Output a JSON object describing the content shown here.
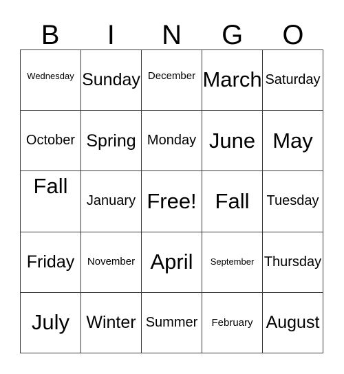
{
  "card": {
    "type": "bingo-card",
    "header_letters": [
      "B",
      "I",
      "N",
      "G",
      "O"
    ],
    "columns": 5,
    "rows": 5,
    "free_space_label": "Free!",
    "free_space_position": {
      "row": 3,
      "column": 3
    },
    "border_color": "#3a3a3a",
    "background_color": "#ffffff",
    "text_color": "#000000",
    "cells": [
      [
        {
          "label": "Wednesday",
          "size": "xs",
          "valign": "hi"
        },
        {
          "label": "Sunday",
          "size": "l",
          "valign": "mid"
        },
        {
          "label": "December",
          "size": "s",
          "valign": "hi"
        },
        {
          "label": "March",
          "size": "xl",
          "valign": "mid"
        },
        {
          "label": "Saturday",
          "size": "m",
          "valign": "mid"
        }
      ],
      [
        {
          "label": "October",
          "size": "m",
          "valign": "mid"
        },
        {
          "label": "Spring",
          "size": "l",
          "valign": "mid"
        },
        {
          "label": "Monday",
          "size": "m",
          "valign": "mid"
        },
        {
          "label": "June",
          "size": "xl",
          "valign": "mid"
        },
        {
          "label": "May",
          "size": "xl",
          "valign": "mid"
        }
      ],
      [
        {
          "label": "Fall",
          "size": "xl",
          "valign": "top"
        },
        {
          "label": "January",
          "size": "m",
          "valign": "mid"
        },
        {
          "label": "Free!",
          "size": "xl",
          "valign": "mid"
        },
        {
          "label": "Fall",
          "size": "xl",
          "valign": "mid"
        },
        {
          "label": "Tuesday",
          "size": "m",
          "valign": "mid"
        }
      ],
      [
        {
          "label": "Friday",
          "size": "l",
          "valign": "mid"
        },
        {
          "label": "November",
          "size": "s",
          "valign": "mid"
        },
        {
          "label": "April",
          "size": "xl",
          "valign": "mid"
        },
        {
          "label": "September",
          "size": "xs",
          "valign": "mid"
        },
        {
          "label": "Thursday",
          "size": "m",
          "valign": "mid"
        }
      ],
      [
        {
          "label": "July",
          "size": "xl",
          "valign": "mid"
        },
        {
          "label": "Winter",
          "size": "l",
          "valign": "mid"
        },
        {
          "label": "Summer",
          "size": "m",
          "valign": "mid"
        },
        {
          "label": "February",
          "size": "s",
          "valign": "mid"
        },
        {
          "label": "August",
          "size": "l",
          "valign": "mid"
        }
      ]
    ]
  }
}
